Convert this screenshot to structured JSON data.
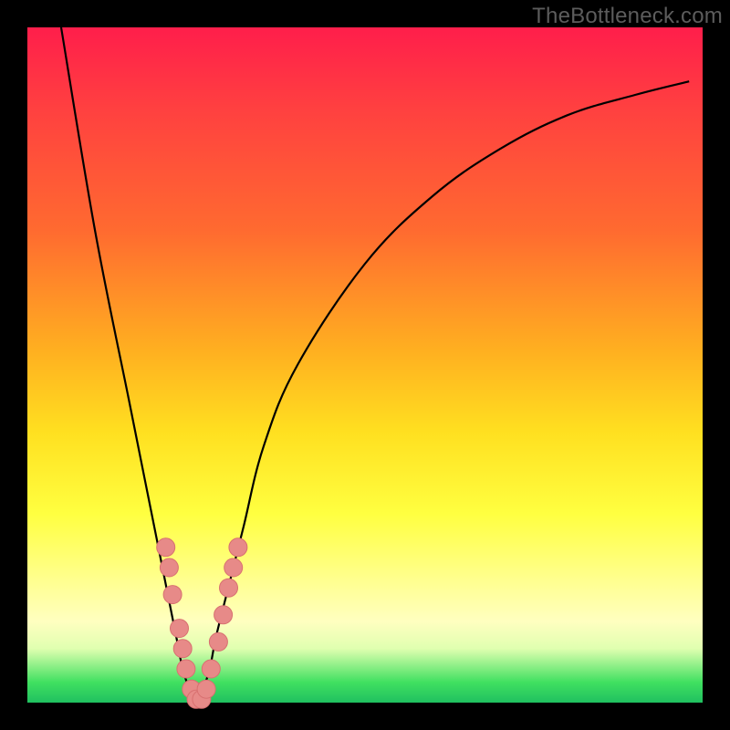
{
  "watermark": "TheBottleneck.com",
  "colors": {
    "frame": "#000000",
    "curve": "#000000",
    "marker_fill": "#e78a88",
    "marker_stroke": "#d87070"
  },
  "chart_data": {
    "type": "line",
    "title": "",
    "xlabel": "",
    "ylabel": "",
    "xlim": [
      0,
      100
    ],
    "ylim": [
      0,
      100
    ],
    "grid": false,
    "curve_note": "V-shaped bottleneck curve; y ≈ 100 means high bottleneck, y ≈ 0 means balanced",
    "x": [
      5,
      10,
      15,
      18,
      20,
      22,
      23,
      24,
      25,
      26,
      27,
      28,
      30,
      32,
      35,
      40,
      50,
      60,
      70,
      80,
      90,
      98
    ],
    "y": [
      100,
      70,
      45,
      30,
      20,
      10,
      5,
      2,
      0,
      2,
      5,
      10,
      18,
      26,
      38,
      50,
      65,
      75,
      82,
      87,
      90,
      92
    ],
    "markers_note": "highlighted points near the minimum of the curve",
    "markers": [
      {
        "x": 20.5,
        "y": 23
      },
      {
        "x": 21.0,
        "y": 20
      },
      {
        "x": 21.5,
        "y": 16
      },
      {
        "x": 22.5,
        "y": 11
      },
      {
        "x": 23.0,
        "y": 8
      },
      {
        "x": 23.5,
        "y": 5
      },
      {
        "x": 24.3,
        "y": 2
      },
      {
        "x": 25.0,
        "y": 0.5
      },
      {
        "x": 25.8,
        "y": 0.5
      },
      {
        "x": 26.5,
        "y": 2
      },
      {
        "x": 27.2,
        "y": 5
      },
      {
        "x": 28.3,
        "y": 9
      },
      {
        "x": 29.0,
        "y": 13
      },
      {
        "x": 29.8,
        "y": 17
      },
      {
        "x": 30.5,
        "y": 20
      },
      {
        "x": 31.2,
        "y": 23
      }
    ]
  }
}
